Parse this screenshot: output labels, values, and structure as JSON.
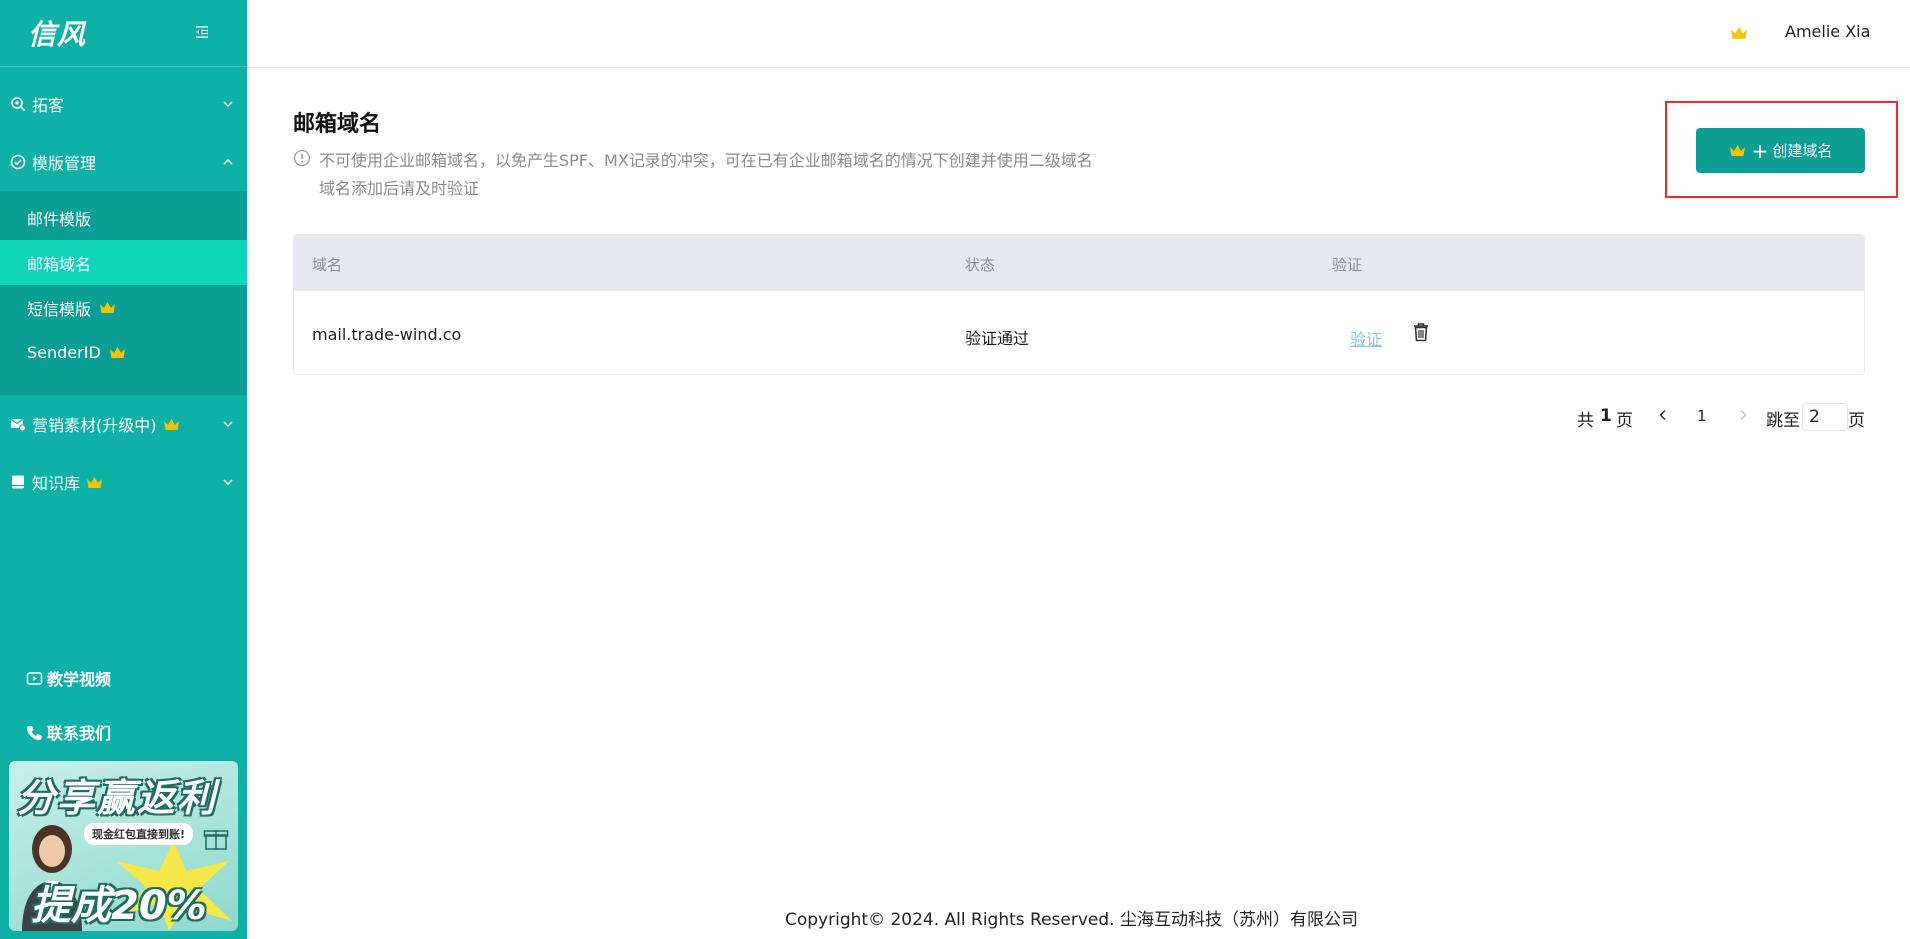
{
  "brand": {
    "logo": "信风"
  },
  "sidebar": {
    "groups": [
      {
        "label": "拓客"
      },
      {
        "label": "模版管理"
      },
      {
        "label": "营销素材(升级中)"
      },
      {
        "label": "知识库"
      }
    ],
    "sub_items": [
      {
        "label": "邮件模版"
      },
      {
        "label": "邮箱域名"
      },
      {
        "label": "短信模版"
      },
      {
        "label": "SenderID"
      }
    ],
    "bottom_links": [
      {
        "label": "教学视频"
      },
      {
        "label": "联系我们"
      }
    ],
    "promo": {
      "title": "分享赢返利",
      "badge": "现金红包直接到账!",
      "big": "提成20%"
    }
  },
  "header": {
    "user_name": "Amelie Xia"
  },
  "main": {
    "title": "邮箱域名",
    "tip_line1": "不可使用企业邮箱域名，以免产生SPF、MX记录的冲突，可在已有企业邮箱域名的情况下创建并使用二级域名",
    "tip_line2": "域名添加后请及时验证",
    "create_button": "创建域名",
    "table": {
      "headers": [
        "域名",
        "状态",
        "验证"
      ],
      "rows": [
        {
          "domain": "mail.trade-wind.co",
          "status": "验证通过",
          "action": "验证"
        }
      ]
    },
    "pagination": {
      "total_prefix": "共",
      "total_pages": "1",
      "total_suffix": "页",
      "current": "1",
      "jump_prefix": "跳至",
      "jump_value": "2",
      "jump_suffix": "页"
    }
  },
  "footer": {
    "copyright": "Copyright© 2024. All Rights Reserved. 尘海互动科技（苏州）有限公司"
  },
  "colors": {
    "sidebar": "#0fb1a6",
    "sidebar_active": "#10d4b8",
    "primary_button": "#0f9e93",
    "crown": "#f5c400",
    "highlight": "#f02a2a",
    "link": "#8cc2f2"
  }
}
